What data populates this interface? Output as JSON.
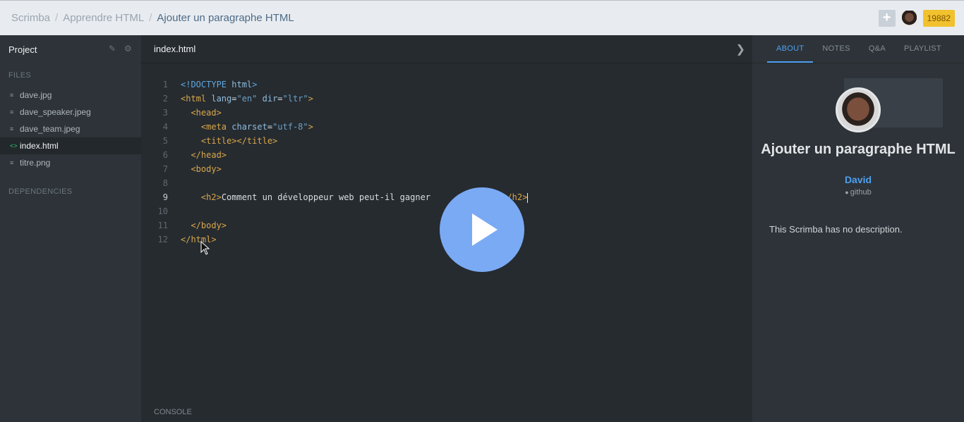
{
  "breadcrumb": {
    "root": "Scrimba",
    "course": "Apprendre HTML",
    "lesson": "Ajouter un paragraphe HTML"
  },
  "header": {
    "add_icon": "plus-icon",
    "points": "19882"
  },
  "sidebar": {
    "project_label": "Project",
    "files_label": "FILES",
    "files": [
      "dave.jpg",
      "dave_speaker.jpeg",
      "dave_team.jpeg",
      "index.html",
      "titre.png"
    ],
    "active_file": "index.html",
    "dependencies_label": "DEPENDENCIES"
  },
  "editor": {
    "tab": "index.html",
    "current_line": 9,
    "lines": [
      "1",
      "2",
      "3",
      "4",
      "5",
      "6",
      "7",
      "8",
      "9",
      "10",
      "11",
      "12"
    ],
    "console_label": "CONSOLE"
  },
  "code": {
    "l1": [
      "<!DOCTYPE",
      " html",
      ">"
    ],
    "l2": [
      "<html",
      " lang",
      "=",
      "\"en\"",
      " dir",
      "=",
      "\"ltr\"",
      ">"
    ],
    "l3": [
      "<head>"
    ],
    "l4": [
      "<meta",
      " charset",
      "=",
      "\"utf-8\"",
      ">"
    ],
    "l5": [
      "<title></title>"
    ],
    "l6": [
      "</head>"
    ],
    "l7": [
      "<body>"
    ],
    "l9_open": "<h2>",
    "l9_text": "Comment un développeur web peut-il gagner",
    "l9_tail": "t ?",
    "l9_close": "</h2>",
    "l11": [
      "</body>"
    ],
    "l12": [
      "</html>"
    ]
  },
  "right_panel": {
    "tabs": [
      "ABOUT",
      "NOTES",
      "Q&A",
      "PLAYLIST"
    ],
    "active_tab": "ABOUT",
    "title": "Ajouter un paragraphe HTML",
    "author": "David",
    "github": "github",
    "description": "This Scrimba has no description."
  },
  "colors": {
    "accent": "#4ea0f0",
    "play": "#7aaaf4",
    "points_badge": "#f2c12e"
  }
}
